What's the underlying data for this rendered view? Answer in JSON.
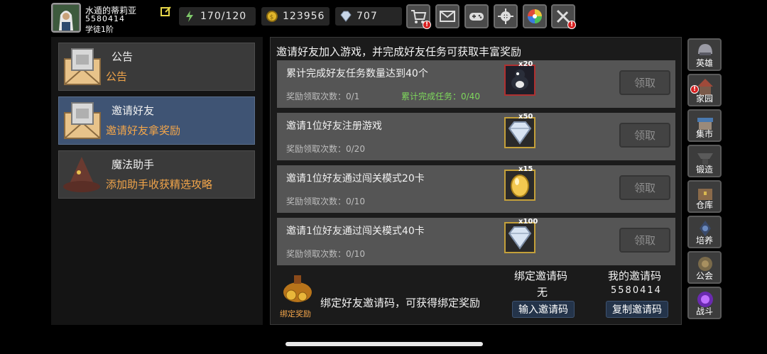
{
  "player": {
    "name": "水遁的蒂莉亚",
    "id": "5580414",
    "rank": "学徒1阶"
  },
  "stats": {
    "energy": "170/120",
    "gold": "123956",
    "gems": "707"
  },
  "top_buttons": [
    "shop",
    "mail",
    "gamepad",
    "settings",
    "color-wheel",
    "tools"
  ],
  "sidebar": {
    "items": [
      {
        "title": "公告",
        "subtitle": "公告"
      },
      {
        "title": "邀请好友",
        "subtitle": "邀请好友拿奖励"
      },
      {
        "title": "魔法助手",
        "subtitle": "添加助手收获精选攻略"
      }
    ]
  },
  "main": {
    "title": "邀请好友加入游戏，并完成好友任务可获取丰富奖励",
    "tasks": [
      {
        "name": "累计完成好友任务数量达到40个",
        "count": "奖励领取次数：0/1",
        "progress": "累计完成任务：0/40",
        "mult": "x20",
        "claim": "领取"
      },
      {
        "name": "邀请1位好友注册游戏",
        "count": "奖励领取次数：0/20",
        "mult": "x50",
        "claim": "领取"
      },
      {
        "name": "邀请1位好友通过闯关模式20卡",
        "count": "奖励领取次数：0/10",
        "mult": "x15",
        "claim": "领取"
      },
      {
        "name": "邀请1位好友通过闯关模式40卡",
        "count": "奖励领取次数：0/10",
        "mult": "x100",
        "claim": "领取"
      }
    ],
    "bind": {
      "gift_label": "绑定奖励",
      "text": "绑定好友邀请码，可获得绑定奖励",
      "bind_header": "绑定邀请码",
      "bind_value": "无",
      "input_button": "输入邀请码",
      "my_header": "我的邀请码",
      "my_code": "5580414",
      "copy_button": "复制邀请码"
    }
  },
  "nav": {
    "items": [
      {
        "label": "英雄"
      },
      {
        "label": "家园"
      },
      {
        "label": "集市"
      },
      {
        "label": "锻造"
      },
      {
        "label": "仓库"
      },
      {
        "label": "培养"
      },
      {
        "label": "公会"
      },
      {
        "label": "战斗"
      }
    ]
  },
  "colors": {
    "accent_orange": "#f2a54a",
    "active_tab": "#3f5474",
    "progress_green": "#7ed85c"
  }
}
